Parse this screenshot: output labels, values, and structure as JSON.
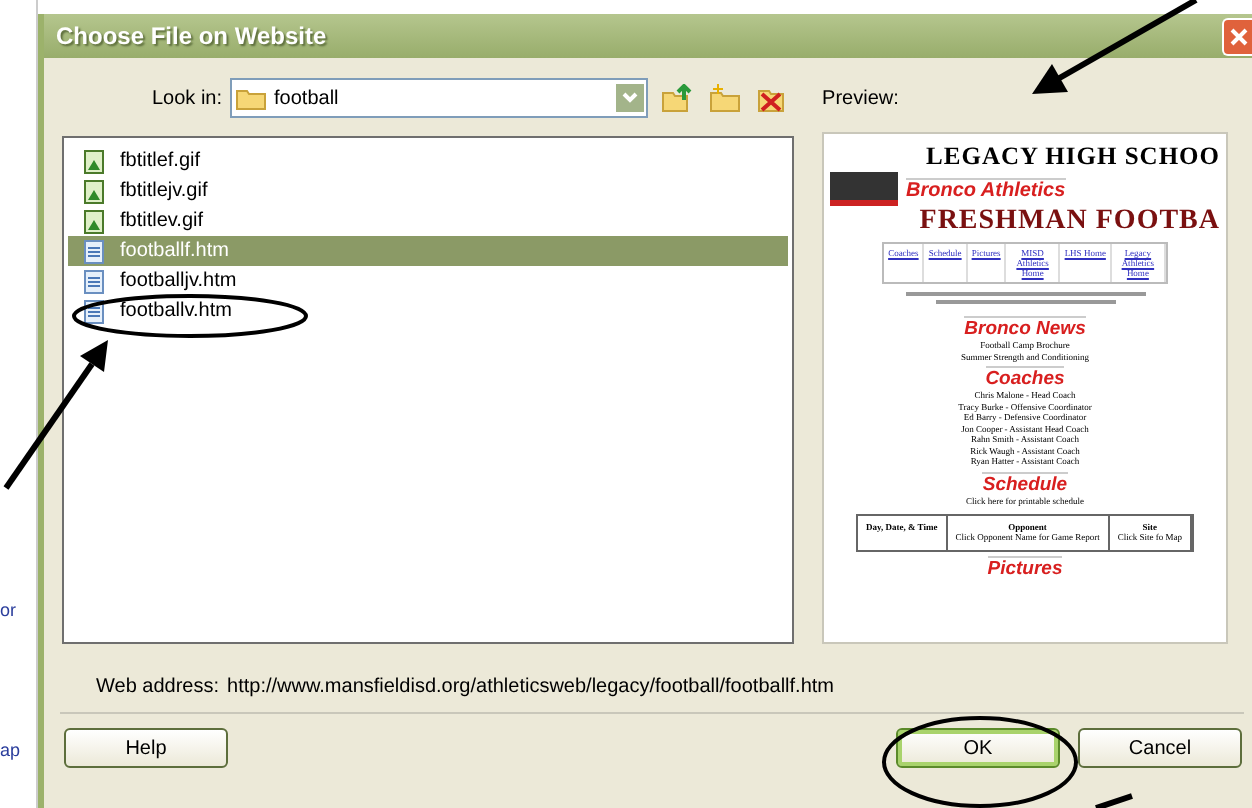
{
  "window": {
    "title": "Choose File on Website"
  },
  "look_in": {
    "label": "Look in:",
    "value": "football"
  },
  "preview_label": "Preview:",
  "files": [
    {
      "name": "fbtitlef.gif",
      "kind": "image",
      "selected": false
    },
    {
      "name": "fbtitlejv.gif",
      "kind": "image",
      "selected": false
    },
    {
      "name": "fbtitlev.gif",
      "kind": "image",
      "selected": false
    },
    {
      "name": "footballf.htm",
      "kind": "page",
      "selected": true
    },
    {
      "name": "footballjv.htm",
      "kind": "page",
      "selected": false
    },
    {
      "name": "footballv.htm",
      "kind": "page",
      "selected": false
    }
  ],
  "preview": {
    "school": "LEGACY HIGH SCHOO",
    "title": "Bronco Athletics",
    "banner": "FRESHMAN FOOTBA",
    "nav": [
      "Coaches",
      "Schedule",
      "Pictures",
      "MISD Athletics Home",
      "LHS Home",
      "Legacy Athletics Home"
    ],
    "sections": [
      {
        "heading": "Bronco News",
        "lines": [
          "Football Camp Brochure",
          "Summer Strength and Conditioning"
        ]
      },
      {
        "heading": "Coaches",
        "lines": [
          "Chris Malone - Head Coach",
          "Tracy Burke - Offensive Coordinator",
          "Ed Barry - Defensive Coordinator",
          "Jon Cooper - Assistant Head Coach",
          "Rahn Smith - Assistant Coach",
          "Rick Waugh - Assistant Coach",
          "Ryan Hatter - Assistant Coach"
        ]
      },
      {
        "heading": "Schedule",
        "lines": [
          "Click here for printable schedule"
        ],
        "table": [
          {
            "title": "Day, Date, & Time"
          },
          {
            "title": "Opponent",
            "note": "Click Opponent Name for Game Report"
          },
          {
            "title": "Site",
            "note": "Click Site fo Map"
          }
        ]
      },
      {
        "heading": "Pictures"
      }
    ]
  },
  "web_address": {
    "label": "Web address:",
    "value": "http://www.mansfieldisd.org/athleticsweb/legacy/football/footballf.htm"
  },
  "buttons": [
    {
      "label": "Help",
      "default": false
    },
    {
      "label": "OK",
      "default": true
    },
    {
      "label": "Cancel",
      "default": false
    }
  ],
  "background_fragments": [
    "or",
    "ap"
  ]
}
